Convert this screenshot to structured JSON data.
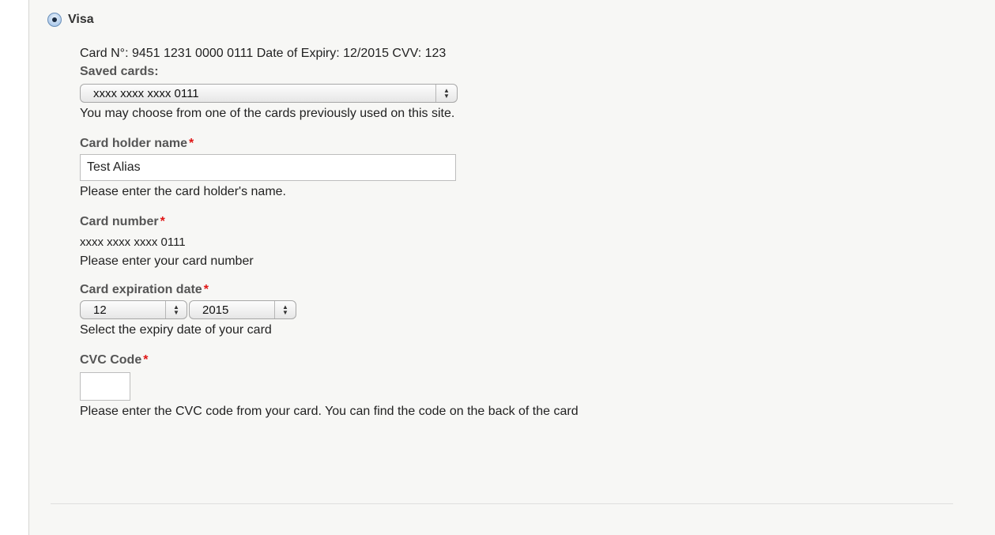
{
  "payment_method": {
    "label": "Visa",
    "selected": true
  },
  "card_info": "Card N°: 9451 1231 0000 0111 Date of Expiry: 12/2015 CVV: 123",
  "saved_cards": {
    "label": "Saved cards:",
    "selected": "xxxx xxxx xxxx 0111",
    "description": "You may choose from one of the cards previously used on this site."
  },
  "card_holder": {
    "label": "Card holder name",
    "required_mark": "*",
    "value": "Test Alias",
    "description": "Please enter the card holder's name."
  },
  "card_number": {
    "label": "Card number",
    "required_mark": "*",
    "value": "xxxx xxxx xxxx 0111",
    "description": "Please enter your card number"
  },
  "expiration": {
    "label": "Card expiration date",
    "required_mark": "*",
    "month": "12",
    "year": "2015",
    "description": "Select the expiry date of your card"
  },
  "cvc": {
    "label": "CVC Code",
    "required_mark": "*",
    "value": "",
    "description": "Please enter the CVC code from your card. You can find the code on the back of the card"
  },
  "colors": {
    "required": "#e01515",
    "label": "#555555",
    "panel_background": "#f7f7f5"
  }
}
